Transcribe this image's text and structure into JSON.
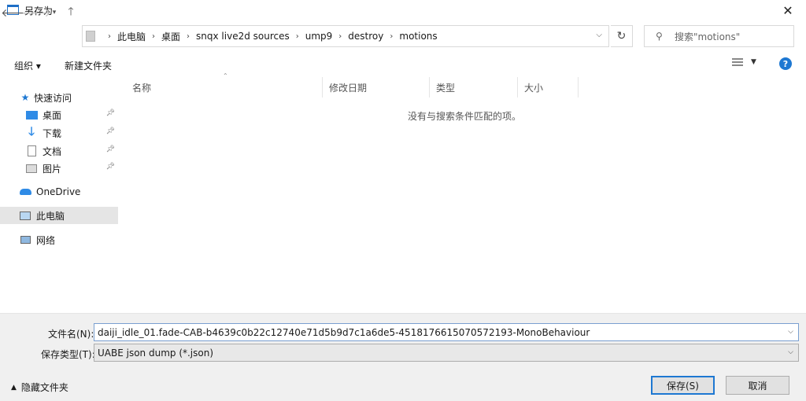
{
  "window": {
    "title": "另存为"
  },
  "nav": {
    "breadcrumb": [
      "此电脑",
      "桌面",
      "snqx live2d sources",
      "ump9",
      "destroy",
      "motions"
    ],
    "search_placeholder": "搜索\"motions\""
  },
  "toolbar": {
    "organize_label": "组织 ▾",
    "new_folder_label": "新建文件夹"
  },
  "sidebar": {
    "quick_access": "快速访问",
    "items": [
      {
        "label": "桌面",
        "icon": "desktop-icon"
      },
      {
        "label": "下载",
        "icon": "download-icon"
      },
      {
        "label": "文档",
        "icon": "document-icon"
      },
      {
        "label": "图片",
        "icon": "picture-icon"
      }
    ],
    "onedrive": "OneDrive",
    "this_pc": "此电脑",
    "network": "网络"
  },
  "columns": [
    "名称",
    "修改日期",
    "类型",
    "大小"
  ],
  "empty_message": "没有与搜索条件匹配的项。",
  "form": {
    "filename_label": "文件名(N):",
    "filename_value": "daiji_idle_01.fade-CAB-b4639c0b22c12740e71d5b9d7c1a6de5-4518176615070572193-MonoBehaviour",
    "filetype_label": "保存类型(T):",
    "filetype_value": "UABE json dump (*.json)"
  },
  "footer": {
    "hide_folders": "隐藏文件夹",
    "save": "保存(S)",
    "cancel": "取消"
  },
  "colors": {
    "accent": "#1e78d2",
    "selection": "#e5e5e5"
  }
}
